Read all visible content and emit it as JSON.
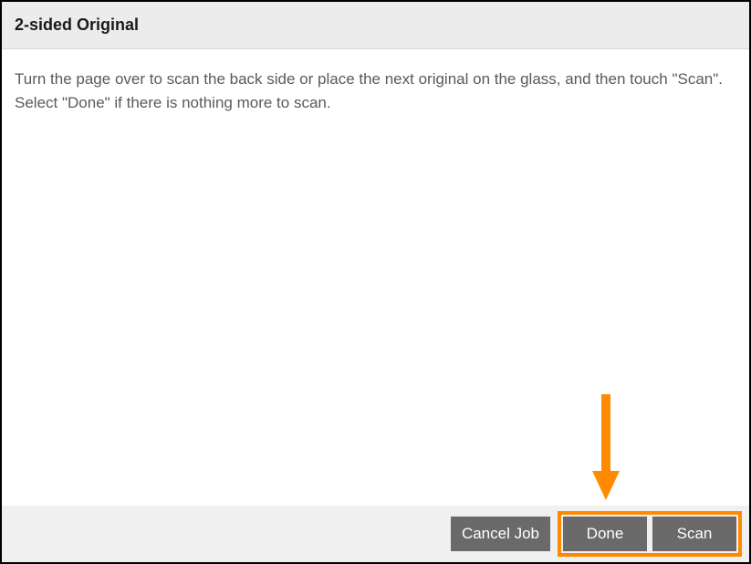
{
  "header": {
    "title": "2-sided Original"
  },
  "content": {
    "instruction": "Turn the page over to scan the back side or place the next original on the glass, and then touch \"Scan\". Select \"Done\" if there is nothing more to scan."
  },
  "footer": {
    "cancel_label": "Cancel Job",
    "done_label": "Done",
    "scan_label": "Scan"
  },
  "annotation": {
    "highlight_color": "#ff8a00"
  }
}
